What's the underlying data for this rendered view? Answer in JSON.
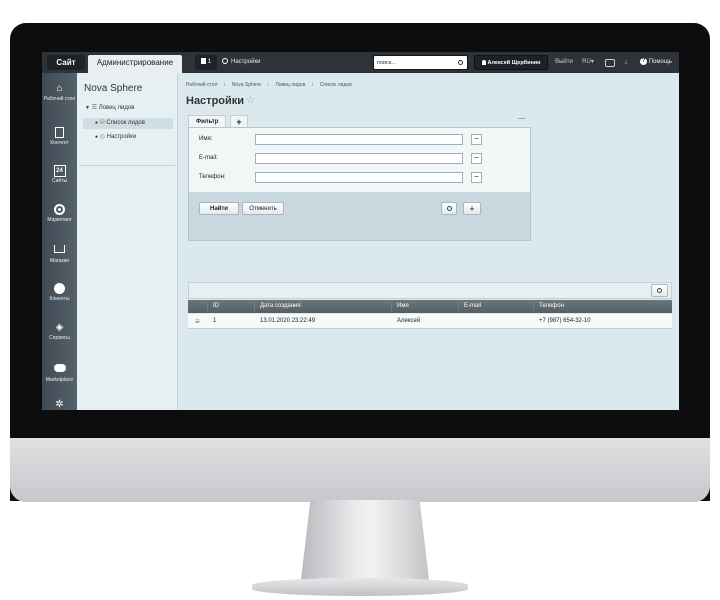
{
  "topbar": {
    "site_tab": "Сайт",
    "admin_tab": "Администрирование",
    "notifications_count": "1",
    "settings_label": "Настройки",
    "search_placeholder": "поиск...",
    "user_name": "Алексей Щербинин",
    "logout": "Выйти",
    "lang": "RU",
    "help": "Помощь"
  },
  "sidebar": {
    "items": [
      {
        "label": "Рабочий стол",
        "icon": "home-icon"
      },
      {
        "label": "Контент",
        "icon": "document-icon"
      },
      {
        "label": "Сайты",
        "icon": "calendar-icon"
      },
      {
        "label": "Маркетинг",
        "icon": "target-icon"
      },
      {
        "label": "Магазин",
        "icon": "cart-icon"
      },
      {
        "label": "Клиенты",
        "icon": "clients-icon"
      },
      {
        "label": "Сервисы",
        "icon": "layers-icon"
      },
      {
        "label": "Marketplace",
        "icon": "cloud-download-icon"
      }
    ],
    "calendar_day": "24"
  },
  "tree": {
    "title": "Nova Sphere",
    "root": "Ловец лидов",
    "children": [
      "Список лидов",
      "Настройки"
    ]
  },
  "breadcrumb": [
    "Рабочий стол",
    "Nova Sphere",
    "Ловец лидов",
    "Список лидов"
  ],
  "page_title": "Настройки",
  "filter": {
    "tab_label": "Фильтр",
    "add_tab": "+",
    "collapse": "—",
    "fields": [
      {
        "label": "Имя:",
        "value": ""
      },
      {
        "label": "E-mail:",
        "value": ""
      },
      {
        "label": "Телефон:",
        "value": ""
      }
    ],
    "find_button": "Найти",
    "cancel_button": "Отменить"
  },
  "table": {
    "columns": [
      "ID",
      "Дата создания",
      "Имя",
      "E-mail",
      "Телефон"
    ],
    "rows": [
      {
        "id": "1",
        "created": "13.01.2020 23:22:49",
        "name": "Алексей",
        "email": "",
        "phone": "+7 (987) 654-32-10"
      }
    ]
  }
}
